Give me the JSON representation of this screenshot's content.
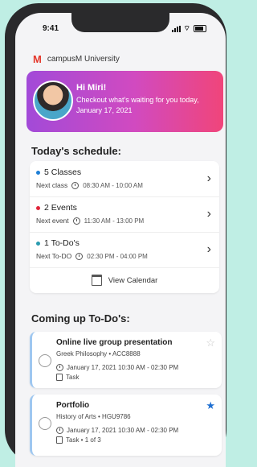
{
  "status": {
    "time": "9:41"
  },
  "brand": {
    "logo": "M",
    "name": "campusM University"
  },
  "greeting": {
    "title": "Hi Miri!",
    "subtitle": "Checkout what's waiting for you today, January 17, 2021"
  },
  "schedule": {
    "heading": "Today's schedule:",
    "items": [
      {
        "title": "5 Classes",
        "dot_color": "#1e7fd6",
        "next_label": "Next class",
        "time": "08:30 AM - 10:00 AM"
      },
      {
        "title": "2 Events",
        "dot_color": "#e0243a",
        "next_label": "Next event",
        "time": "11:30 AM - 13:00 PM"
      },
      {
        "title": "1 To-Do's",
        "dot_color": "#2a9bb0",
        "next_label": "Next To-DO",
        "time": "02:30 PM - 04:00 PM"
      }
    ],
    "calendar_button": "View Calendar"
  },
  "todos": {
    "heading": "Coming up To-Do's:",
    "items": [
      {
        "title": "Online live group presentation",
        "course": "Greek Philosophy • ACC8888",
        "when": "January 17, 2021 10:30 AM - 02:30 PM",
        "kind": "Task",
        "starred": false
      },
      {
        "title": "Portfolio",
        "course": "History of Arts • HGU9786",
        "when": "January 17, 2021 10:30 AM - 02:30 PM",
        "kind": "Task • 1 of 3",
        "starred": true
      }
    ]
  },
  "colors": {
    "star_active": "#1f6fd1",
    "star_inactive": "#c8c8c8"
  }
}
